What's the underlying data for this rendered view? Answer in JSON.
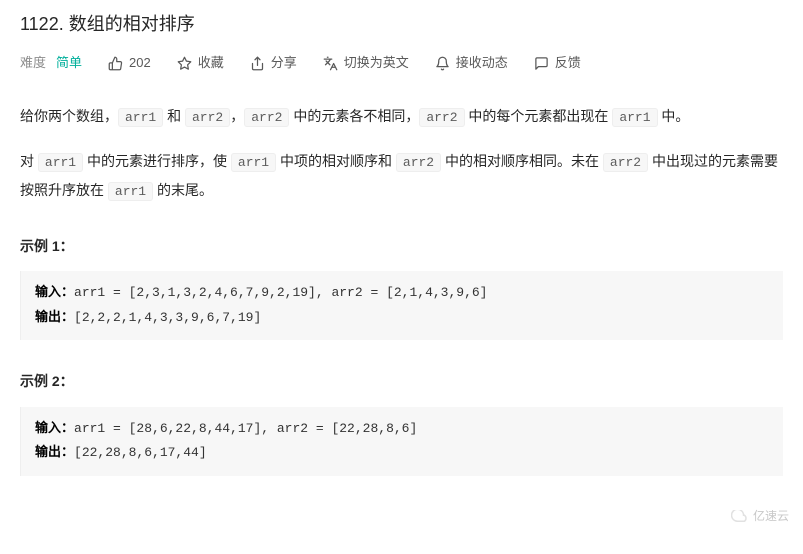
{
  "title": "1122. 数组的相对排序",
  "meta": {
    "difficulty_label": "难度",
    "difficulty_value": "简单",
    "likes": "202",
    "favorite": "收藏",
    "share": "分享",
    "switch_lang": "切换为英文",
    "notifications": "接收动态",
    "feedback": "反馈"
  },
  "desc": {
    "p1a": "给你两个数组，",
    "c1": "arr1",
    "p1b": " 和 ",
    "c2": "arr2",
    "p1c": "，",
    "c3": "arr2",
    "p1d": " 中的元素各不相同，",
    "c4": "arr2",
    "p1e": " 中的每个元素都出现在 ",
    "c5": "arr1",
    "p1f": " 中。",
    "p2a": "对 ",
    "c6": "arr1",
    "p2b": " 中的元素进行排序，使 ",
    "c7": "arr1",
    "p2c": " 中项的相对顺序和 ",
    "c8": "arr2",
    "p2d": " 中的相对顺序相同。未在 ",
    "c9": "arr2",
    "p2e": " 中出现过的元素需要按照升序放在 ",
    "c10": "arr1",
    "p2f": " 的末尾。"
  },
  "examples": {
    "ex1_title": "示例 1：",
    "ex1_input_label": "输入：",
    "ex1_input": "arr1 = [2,3,1,3,2,4,6,7,9,2,19], arr2 = [2,1,4,3,9,6]",
    "ex1_output_label": "输出：",
    "ex1_output": "[2,2,2,1,4,3,3,9,6,7,19]",
    "ex2_title": "示例  2：",
    "ex2_input_label": "输入：",
    "ex2_input": "arr1 = [28,6,22,8,44,17], arr2 = [22,28,8,6]",
    "ex2_output_label": "输出：",
    "ex2_output": "[22,28,8,6,17,44]"
  },
  "watermark": "亿速云"
}
